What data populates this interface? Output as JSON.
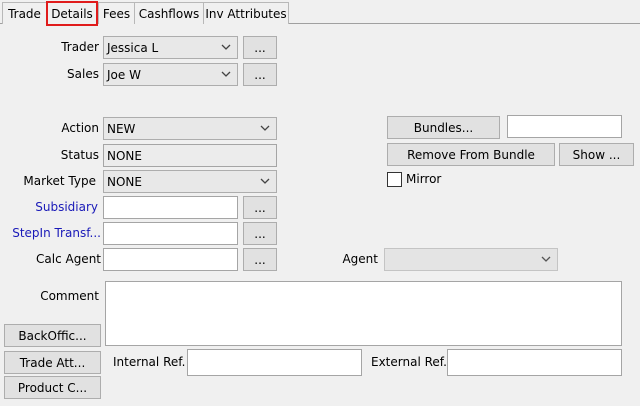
{
  "tabs": [
    {
      "label": "Trade"
    },
    {
      "label": "Details"
    },
    {
      "label": "Fees"
    },
    {
      "label": "Cashflows"
    },
    {
      "label": "Inv Attributes"
    }
  ],
  "trader": {
    "label": "Trader",
    "value": "Jessica L",
    "lookup": "..."
  },
  "sales": {
    "label": "Sales",
    "value": "Joe W",
    "lookup": "..."
  },
  "action": {
    "label": "Action",
    "value": "NEW"
  },
  "status": {
    "label": "Status",
    "value": "NONE"
  },
  "market_type": {
    "label": "Market Type",
    "value": "NONE"
  },
  "subsidiary": {
    "label": "Subsidiary",
    "value": "",
    "lookup": "..."
  },
  "stepin": {
    "label": "StepIn Transf...",
    "value": "",
    "lookup": "..."
  },
  "calc_agent": {
    "label": "Calc Agent",
    "value": "",
    "lookup": "..."
  },
  "agent": {
    "label": "Agent",
    "value": ""
  },
  "bundles": {
    "button": "Bundles...",
    "value": "",
    "remove_button": "Remove From Bundle",
    "show_button": "Show ..."
  },
  "mirror": {
    "label": "Mirror",
    "checked": false
  },
  "comment": {
    "label": "Comment",
    "value": ""
  },
  "side_buttons": {
    "back_office": "BackOffic...",
    "trade_attr": "Trade Att...",
    "product": "Product C..."
  },
  "internal_ref": {
    "label": "Internal Ref.",
    "value": ""
  },
  "external_ref": {
    "label": "External Ref.",
    "value": ""
  },
  "colors": {
    "active_tab_border": "#e01b1b",
    "link_label": "#1a1ab8",
    "background": "#f0f0f0"
  }
}
